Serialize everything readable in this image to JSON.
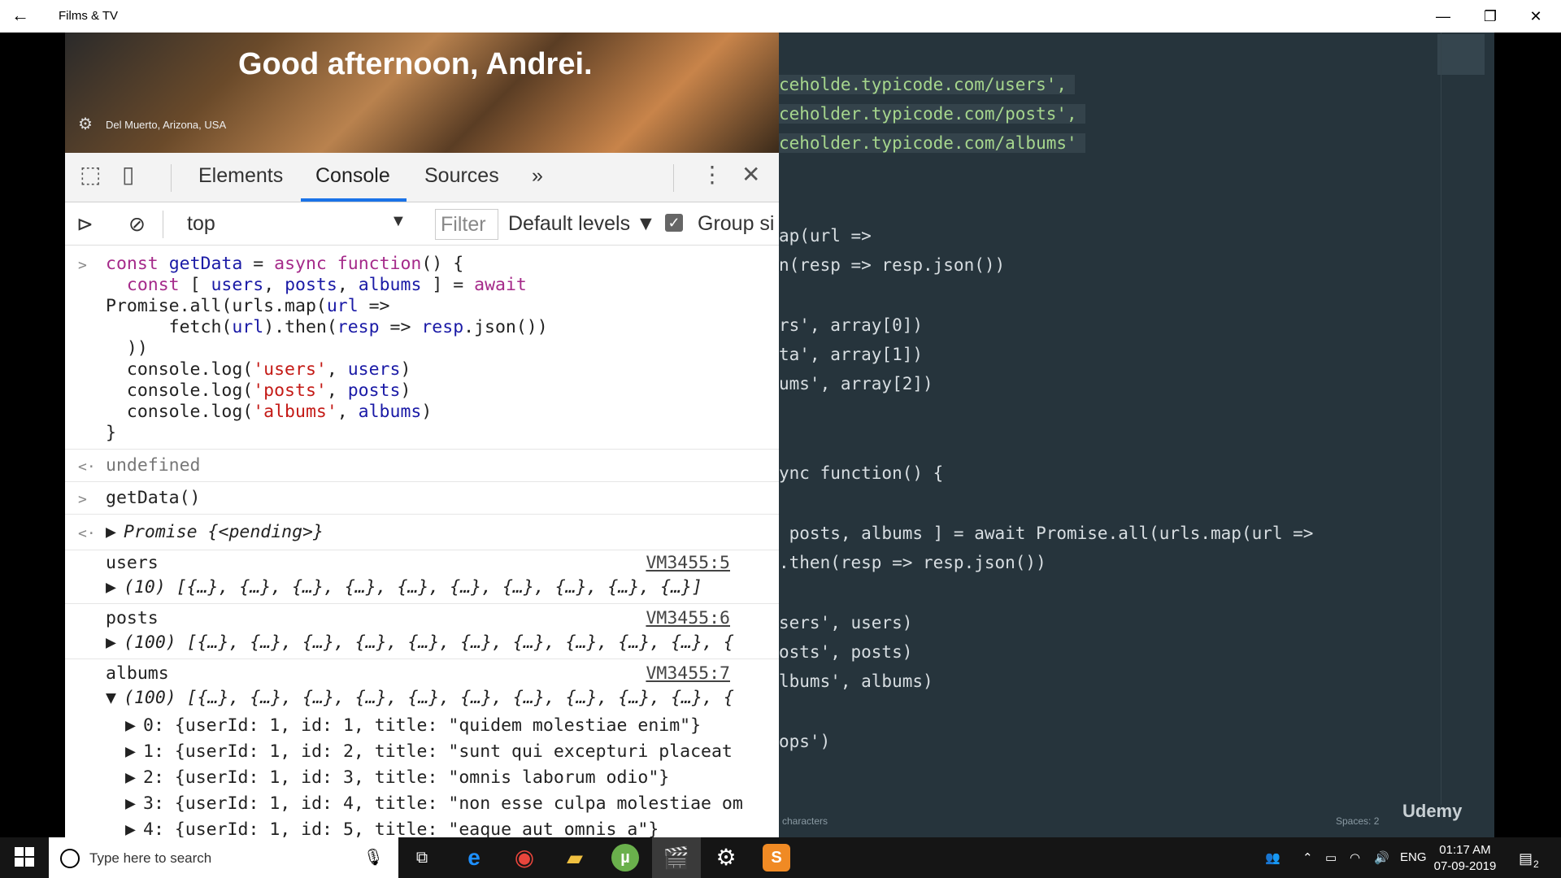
{
  "window": {
    "title": "Films & TV",
    "back_icon": "back-arrow-icon",
    "minimize": "—",
    "restore": "❐",
    "close": "✕"
  },
  "banner": {
    "greeting": "Good afternoon, Andrei.",
    "location": "Del Muerto, Arizona, USA"
  },
  "devtools": {
    "tabs": [
      "Elements",
      "Console",
      "Sources"
    ],
    "active_tab": "Console",
    "more": "»",
    "context": "top",
    "filter_placeholder": "Filter",
    "levels": "Default levels ▼",
    "group": "Group si"
  },
  "console": {
    "code": [
      "const getData = async function() {",
      "  const [ users, posts, albums ] = await",
      "Promise.all(urls.map(url =>",
      "      fetch(url).then(resp => resp.json())",
      "  ))",
      "  console.log('users', users)",
      "  console.log('posts', posts)",
      "  console.log('albums', albums)",
      "}"
    ],
    "undefined": "undefined",
    "call": "getData()",
    "promise": "Promise {<pending>}",
    "logs": [
      {
        "label": "users",
        "source": "VM3455:5",
        "value": "(10) [{…}, {…}, {…}, {…}, {…}, {…}, {…}, {…}, {…}, {…}]"
      },
      {
        "label": "posts",
        "source": "VM3455:6",
        "value": "(100) [{…}, {…}, {…}, {…}, {…}, {…}, {…}, {…}, {…}, {…}, {"
      },
      {
        "label": "albums",
        "source": "VM3455:7",
        "value": "(100) [{…}, {…}, {…}, {…}, {…}, {…}, {…}, {…}, {…}, {…}, {"
      }
    ],
    "items": [
      "0: {userId: 1, id: 1, title: \"quidem molestiae enim\"}",
      "1: {userId: 1, id: 2, title: \"sunt qui excepturi placeat",
      "2: {userId: 1, id: 3, title: \"omnis laborum odio\"}",
      "3: {userId: 1, id: 4, title: \"non esse culpa molestiae om",
      "4: {userId: 1, id: 5, title: \"eaque aut omnis a\"}"
    ]
  },
  "editor": {
    "lines": [
      "ceholde.typicode.com/users',",
      "ceholder.typicode.com/posts',",
      "ceholder.typicode.com/albums'",
      "ap(url =>",
      "n(resp => resp.json())",
      "rs', array[0])",
      "ta', array[1])",
      "ums', array[2])",
      "ync function() {",
      " posts, albums ] = await Promise.all(urls.map(url =>",
      ".then(resp => resp.json())",
      "sers', users)",
      "osts', posts)",
      "lbums', albums)",
      "ops')"
    ],
    "status_left": "characters",
    "status_right": "Spaces: 2",
    "brand": "Udemy"
  },
  "taskbar": {
    "search_placeholder": "Type here to search",
    "language": "ENG",
    "time": "01:17 AM",
    "date": "07-09-2019",
    "notifications": "2"
  }
}
